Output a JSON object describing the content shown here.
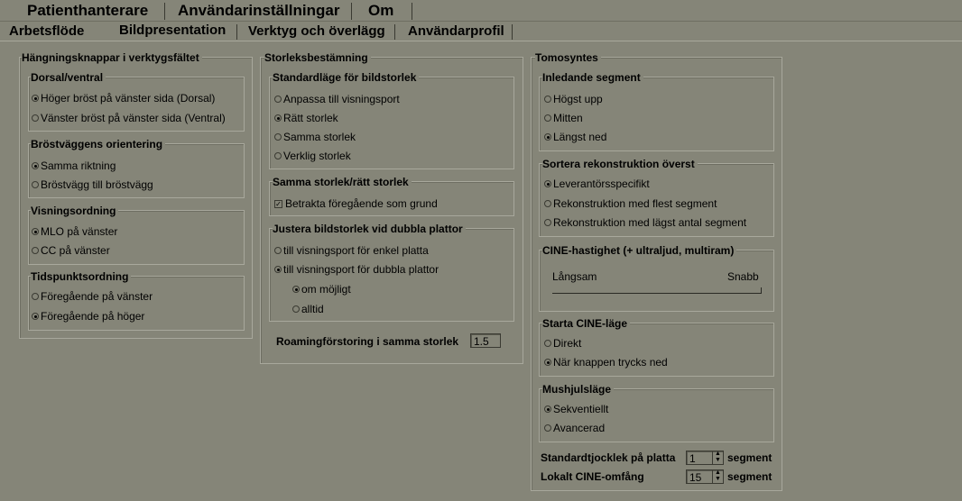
{
  "top_tabs": [
    "Patienthanterare",
    "Användarinställningar",
    "Om"
  ],
  "sub_tabs": [
    "Arbetsflöde",
    "Bildpresentation",
    "Verktyg och överlägg",
    "Användarprofil"
  ],
  "col1": {
    "title": "Hängningsknappar i verktygsfältet",
    "dorsal": {
      "title": "Dorsal/ventral",
      "options": [
        "Höger bröst på vänster sida (Dorsal)",
        "Vänster bröst på vänster sida (Ventral)"
      ],
      "selected": 0
    },
    "brost": {
      "title": "Bröstväggens orientering",
      "options": [
        "Samma riktning",
        "Bröstvägg till bröstvägg"
      ],
      "selected": 0
    },
    "visning": {
      "title": "Visningsordning",
      "options": [
        "MLO på vänster",
        "CC på vänster"
      ],
      "selected": 0
    },
    "tids": {
      "title": "Tidspunktsordning",
      "options": [
        "Föregående på vänster",
        "Föregående på höger"
      ],
      "selected": 1
    }
  },
  "col2": {
    "title": "Storleksbestämning",
    "standard": {
      "title": "Standardläge för bildstorlek",
      "options": [
        "Anpassa till visningsport",
        "Rätt storlek",
        "Samma storlek",
        "Verklig storlek"
      ],
      "selected": 1
    },
    "samma": {
      "title": "Samma storlek/rätt storlek",
      "checkbox": "Betrakta föregående som grund",
      "checked": true
    },
    "justera": {
      "title": "Justera bildstorlek vid dubbla plattor",
      "options": [
        "till visningsport för enkel platta",
        "till visningsport för dubbla plattor"
      ],
      "selected": 1,
      "sub_options": [
        "om möjligt",
        "alltid"
      ],
      "sub_selected": 0
    },
    "roaming_label": "Roamingförstoring i samma storlek",
    "roaming_value": "1.5"
  },
  "col3": {
    "title": "Tomosyntes",
    "inledande": {
      "title": "Inledande segment",
      "options": [
        "Högst upp",
        "Mitten",
        "Längst ned"
      ],
      "selected": 2
    },
    "sortera": {
      "title": "Sortera rekonstruktion överst",
      "options": [
        "Leverantörsspecifikt",
        "Rekonstruktion med flest segment",
        "Rekonstruktion med lägst antal segment"
      ],
      "selected": 0
    },
    "cine": {
      "title": "CINE-hastighet (+ ultraljud, multiram)",
      "slow": "Långsam",
      "fast": "Snabb",
      "level": 1.0
    },
    "starta": {
      "title": "Starta CINE-läge",
      "options": [
        "Direkt",
        "När knappen trycks ned"
      ],
      "selected": 1
    },
    "mushjul": {
      "title": "Mushjulsläge",
      "options": [
        "Sekventiellt",
        "Avancerad"
      ],
      "selected": 0
    },
    "tjocklek_label": "Standardtjocklek på platta",
    "tjocklek_value": "1",
    "cine_range_label": "Lokalt CINE-omfång",
    "cine_range_value": "15",
    "unit": "segment"
  }
}
